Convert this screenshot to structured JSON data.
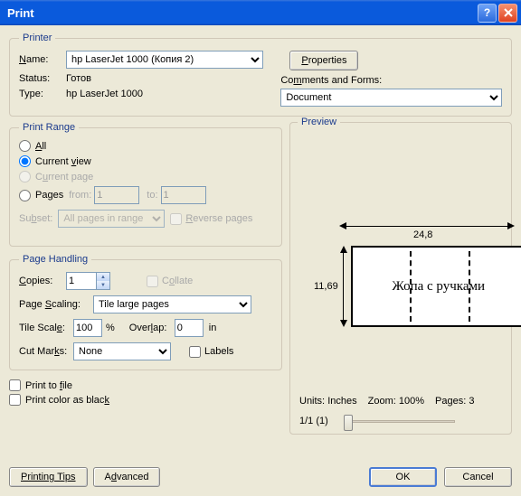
{
  "title": "Print",
  "printer": {
    "legend": "Printer",
    "name_label": "Name:",
    "name_value": "hp LaserJet 1000 (Копия 2)",
    "status_label": "Status:",
    "status_value": "Готов",
    "type_label": "Type:",
    "type_value": "hp LaserJet 1000",
    "properties_btn": "Properties",
    "comments_label": "Comments and Forms:",
    "comments_value": "Document"
  },
  "range": {
    "legend": "Print Range",
    "all": "All",
    "current_view": "Current view",
    "current_page": "Current page",
    "pages": "Pages",
    "from": "from:",
    "from_val": "1",
    "to": "to:",
    "to_val": "1",
    "subset_label": "Subset:",
    "subset_value": "All pages in range",
    "reverse": "Reverse pages"
  },
  "handling": {
    "legend": "Page Handling",
    "copies_label": "Copies:",
    "copies_value": "1",
    "collate": "Collate",
    "scaling_label": "Page Scaling:",
    "scaling_value": "Tile large pages",
    "tilescale_label": "Tile Scale:",
    "tilescale_value": "100",
    "percent": "%",
    "overlap_label": "Overlap:",
    "overlap_value": "0",
    "overlap_unit": "in",
    "cutmarks_label": "Cut Marks:",
    "cutmarks_value": "None",
    "labels": "Labels"
  },
  "extra": {
    "print_to_file": "Print to file",
    "print_black": "Print color as black"
  },
  "preview": {
    "legend": "Preview",
    "width": "24,8",
    "height": "11,69",
    "text": "Жопа с ручками",
    "units_label": "Units:",
    "units_value": "Inches",
    "zoom_label": "Zoom:",
    "zoom_value": "100%",
    "pages_label": "Pages:",
    "pages_value": "3",
    "position": "1/1 (1)"
  },
  "buttons": {
    "tips": "Printing Tips",
    "advanced": "Advanced",
    "ok": "OK",
    "cancel": "Cancel"
  }
}
